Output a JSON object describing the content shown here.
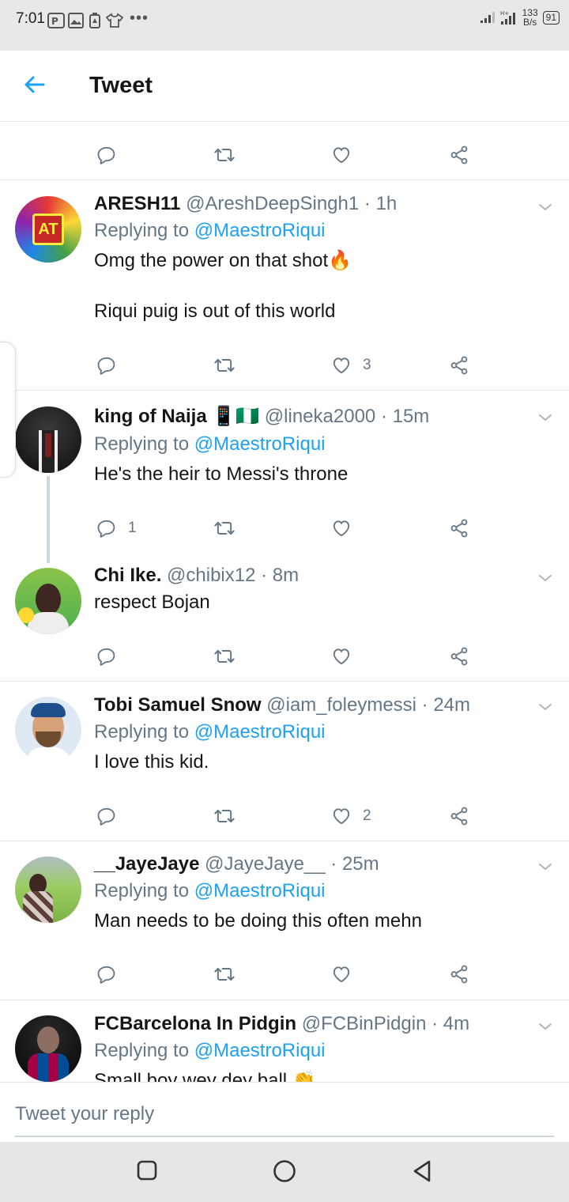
{
  "status_bar": {
    "time": "7:01",
    "dots": "•••",
    "speed_value": "133",
    "speed_unit": "B/s",
    "battery": "91"
  },
  "header": {
    "title": "Tweet"
  },
  "tweets": [
    {
      "name": "ARESH11",
      "handle": "@AreshDeepSingh1",
      "time": "· 1h",
      "replying_prefix": "Replying to",
      "replying_to": "@MaestroRiqui",
      "text": "Omg the power on that shot🔥\n\nRiqui puig is out of this world",
      "replies": "",
      "likes": "3"
    },
    {
      "name": "king of Naija",
      "name_emoji": "📱🇳🇬",
      "handle": "@lineka2000",
      "time": "· 15m",
      "replying_prefix": "Replying to",
      "replying_to": "@MaestroRiqui",
      "text": "He's the heir to Messi's throne",
      "replies": "1",
      "likes": ""
    },
    {
      "name": "Chi Ike.",
      "handle": "@chibix12",
      "time": "· 8m",
      "text": "respect Bojan",
      "replies": "",
      "likes": ""
    },
    {
      "name": "Tobi Samuel Snow",
      "handle": "@iam_foleymessi",
      "time": "· 24m",
      "replying_prefix": "Replying to",
      "replying_to": "@MaestroRiqui",
      "text": "I love this kid.",
      "replies": "",
      "likes": "2"
    },
    {
      "name": "__JayeJaye",
      "handle": "@JayeJaye__",
      "time": "· 25m",
      "replying_prefix": "Replying to",
      "replying_to": "@MaestroRiqui",
      "text": "Man needs to be doing this often mehn",
      "replies": "",
      "likes": ""
    },
    {
      "name": "FCBarcelona In Pidgin",
      "handle": "@FCBinPidgin",
      "time": "· 4m",
      "replying_prefix": "Replying to",
      "replying_to": "@MaestroRiqui",
      "text": "Small boy wey dey ball 👏",
      "replies": "",
      "likes": ""
    }
  ],
  "composer": {
    "placeholder": "Tweet your reply"
  },
  "colors": {
    "accent": "#1da1f2",
    "muted": "#657786",
    "text": "#14171a"
  },
  "icons": [
    "back-arrow-icon",
    "reply-icon",
    "retweet-icon",
    "like-icon",
    "share-icon",
    "chevron-down-icon"
  ]
}
